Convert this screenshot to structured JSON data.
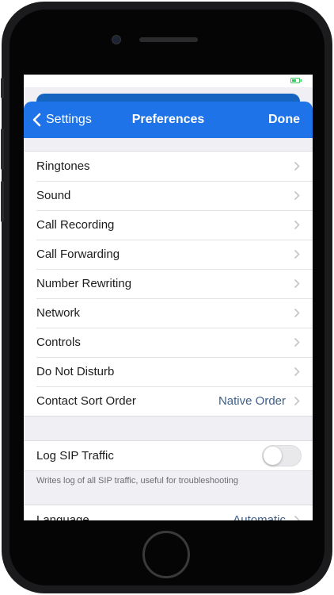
{
  "navbar": {
    "back_label": "Settings",
    "title": "Preferences",
    "done_label": "Done"
  },
  "colors": {
    "navbar": "#1e73e8",
    "value_text": "#3e5f8a",
    "battery": "#34c759"
  },
  "group1": {
    "items": [
      {
        "label": "Ringtones"
      },
      {
        "label": "Sound"
      },
      {
        "label": "Call Recording"
      },
      {
        "label": "Call Forwarding"
      },
      {
        "label": "Number Rewriting"
      },
      {
        "label": "Network"
      },
      {
        "label": "Controls"
      },
      {
        "label": "Do Not Disturb"
      },
      {
        "label": "Contact Sort Order",
        "value": "Native Order"
      }
    ]
  },
  "sip": {
    "label": "Log SIP Traffic",
    "enabled": false,
    "footnote": "Writes log of all SIP traffic, useful for troubleshooting"
  },
  "language": {
    "label": "Language",
    "value": "Automatic"
  }
}
